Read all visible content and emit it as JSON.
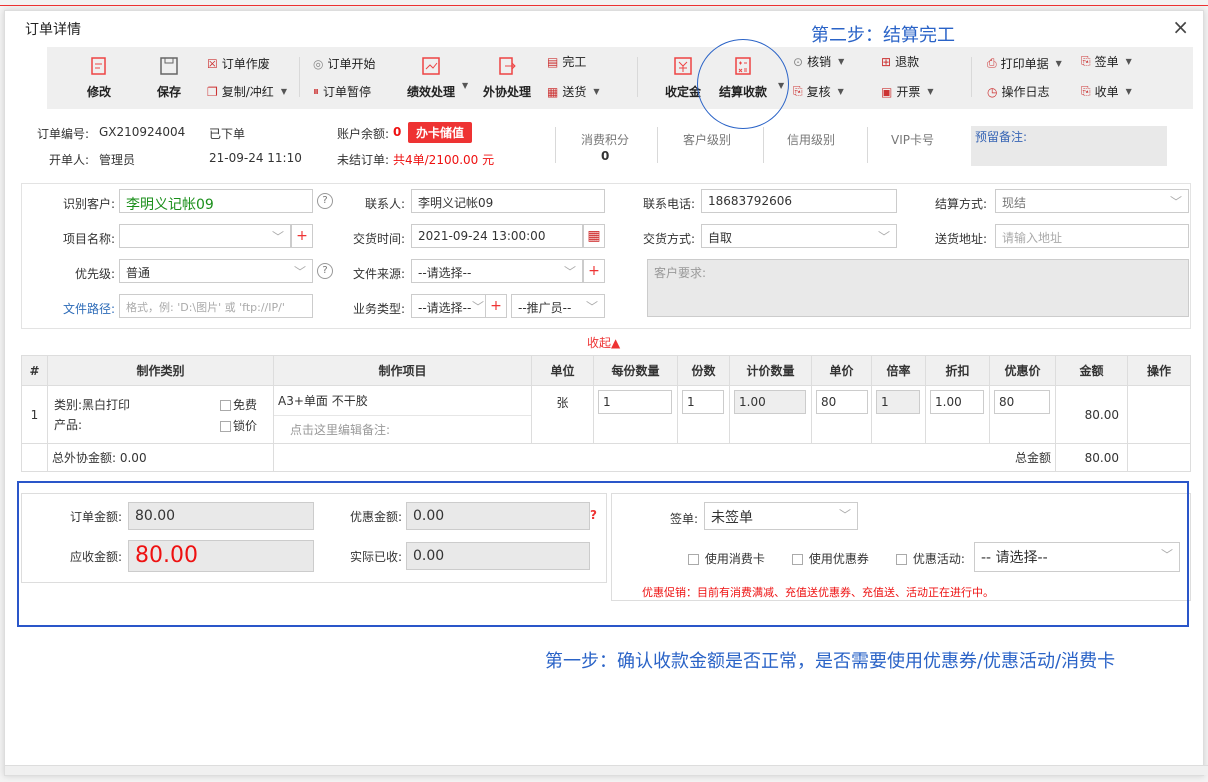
{
  "dialog": {
    "title": "订单详情",
    "close": "×"
  },
  "annotations": {
    "step2": "第二步：结算完工",
    "step1": "第一步：确认收款金额是否正常，是否需要使用优惠券/优惠活动/消费卡"
  },
  "toolbar": {
    "edit": "修改",
    "save": "保存",
    "void": "订单作废",
    "copy": "复制/冲红",
    "start": "订单开始",
    "pause": "订单暂停",
    "perf": "绩效处理",
    "outsource": "外协处理",
    "finish": "完工",
    "deliver": "送货",
    "deposit": "收定金",
    "settle": "结算收款",
    "writeoff": "核销",
    "recheck": "复核",
    "refund": "退款",
    "invoice": "开票",
    "print": "打印单据",
    "log": "操作日志",
    "sign": "签单",
    "collect": "收单"
  },
  "order_info": {
    "no_label": "订单编号:",
    "no": "GX210924004",
    "status": "已下单",
    "creator_label": "开单人:",
    "creator": "管理员",
    "date": "21-09-24 11:10",
    "balance_label": "账户余额:",
    "balance": "0",
    "card_btn": "办卡储值",
    "unsettled_label": "未结订单:",
    "unsettled": "共4单/2100.00 元",
    "points_label": "消费积分",
    "points": "0",
    "level_label": "客户级别",
    "credit_label": "信用级别",
    "vip_label": "VIP卡号",
    "remark_label": "预留备注:"
  },
  "form": {
    "customer_label": "识别客户:",
    "customer": "李明义记帐09",
    "contact_label": "联系人:",
    "contact": "李明义记帐09",
    "phone_label": "联系电话:",
    "phone": "18683792606",
    "settle_label": "结算方式:",
    "settle": "现结",
    "project_label": "项目名称:",
    "project": "",
    "delivery_time_label": "交货时间:",
    "delivery_time": "2021-09-24 13:00:00",
    "delivery_mode_label": "交货方式:",
    "delivery_mode": "自取",
    "address_label": "送货地址:",
    "address_ph": "请输入地址",
    "priority_label": "优先级:",
    "priority": "普通",
    "source_label": "文件来源:",
    "source": "--请选择--",
    "req_label": "客户要求:",
    "path_label": "文件路径:",
    "path_ph": "格式，例: 'D:\\图片' 或 'ftp://IP/'",
    "biz_label": "业务类型:",
    "biz": "--请选择--",
    "promoter": "--推广员--",
    "collapse": "收起▲"
  },
  "table": {
    "headers": [
      "#",
      "制作类别",
      "制作项目",
      "单位",
      "每份数量",
      "份数",
      "计价数量",
      "单价",
      "倍率",
      "折扣",
      "优惠价",
      "金额",
      "操作"
    ],
    "row": {
      "idx": "1",
      "category": "类别:黑白打印",
      "product": "产品:",
      "free": "免费",
      "lock": "锁价",
      "item": "A3+单面 不干胶",
      "remark_ph": "点击这里编辑备注:",
      "unit": "张",
      "per_qty": "1",
      "copies": "1",
      "price_qty": "1.00",
      "price": "80",
      "rate": "1",
      "discount": "1.00",
      "promo_price": "80",
      "amount": "80.00"
    },
    "footer": {
      "outsource": "总外协金额:  0.00",
      "total_label": "总金额",
      "total": "80.00"
    }
  },
  "summary": {
    "order_amount_label": "订单金额:",
    "order_amount": "80.00",
    "discount_label": "优惠金额:",
    "discount": "0.00",
    "receivable_label": "应收金额:",
    "receivable": "80.00",
    "received_label": "实际已收:",
    "received": "0.00",
    "sign_label": "签单:",
    "sign": "未签单",
    "use_card": "使用消费卡",
    "use_coupon": "使用优惠券",
    "promo_label": "优惠活动:",
    "promo": "-- 请选择--",
    "promo_tip": "优惠促销：目前有消费满减、充值送优惠券、充值送、活动正在进行中。"
  }
}
